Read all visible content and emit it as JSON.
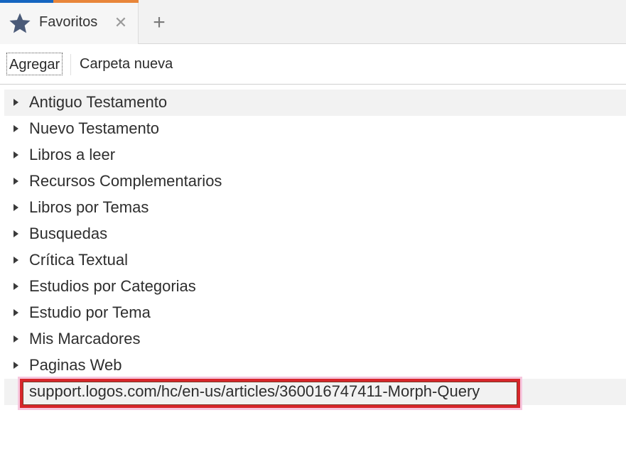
{
  "tab": {
    "label": "Favoritos",
    "close_glyph": "✕",
    "add_glyph": "+",
    "icon": "star-icon",
    "accent_colors": [
      "#1565c0",
      "#e8863a"
    ]
  },
  "toolbar": {
    "add_label": "Agregar",
    "new_folder_label": "Carpeta nueva"
  },
  "tree": {
    "items": [
      {
        "label": "Antiguo Testamento"
      },
      {
        "label": "Nuevo Testamento"
      },
      {
        "label": "Libros a leer"
      },
      {
        "label": "Recursos Complementarios"
      },
      {
        "label": "Libros por Temas"
      },
      {
        "label": "Busquedas"
      },
      {
        "label": "Crítica Textual"
      },
      {
        "label": "Estudios por Categorias"
      },
      {
        "label": "Estudio por Tema"
      },
      {
        "label": "Mis Marcadores"
      },
      {
        "label": "Paginas Web"
      }
    ],
    "link": {
      "label": "support.logos.com/hc/en-us/articles/360016747411-Morph-Query",
      "highlight_color": "#d7262b"
    }
  }
}
